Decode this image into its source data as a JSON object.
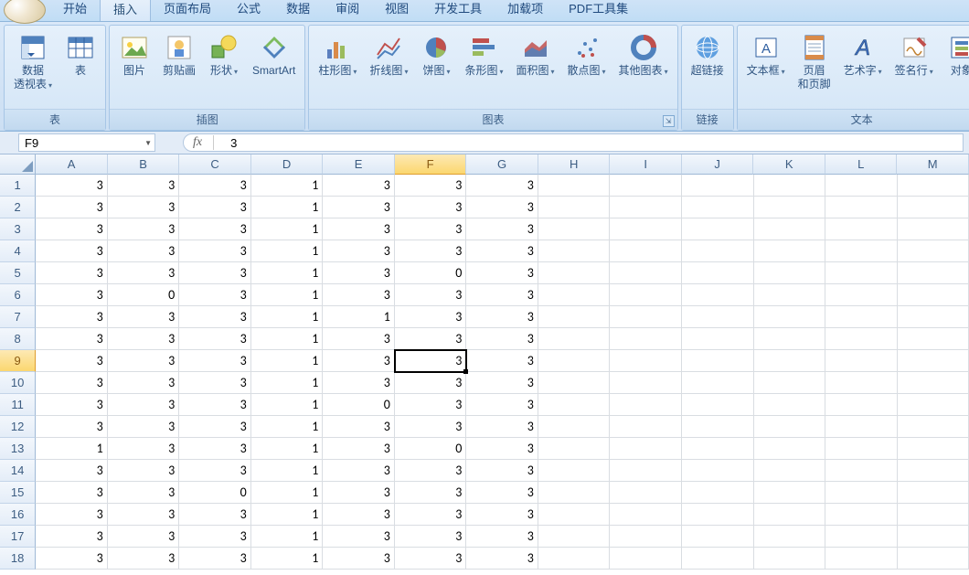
{
  "tabs": {
    "items": [
      "开始",
      "插入",
      "页面布局",
      "公式",
      "数据",
      "审阅",
      "视图",
      "开发工具",
      "加载项",
      "PDF工具集"
    ],
    "active_index": 1
  },
  "ribbon": {
    "groups": [
      {
        "label": "表",
        "items": [
          {
            "name": "pivot-table",
            "text": "数据\n透视表",
            "dd": true,
            "icon": "pivot"
          },
          {
            "name": "table",
            "text": "表",
            "icon": "table"
          }
        ]
      },
      {
        "label": "插图",
        "items": [
          {
            "name": "picture",
            "text": "图片",
            "icon": "picture"
          },
          {
            "name": "clipart",
            "text": "剪贴画",
            "icon": "clipart"
          },
          {
            "name": "shapes",
            "text": "形状",
            "dd": true,
            "icon": "shapes"
          },
          {
            "name": "smartart",
            "text": "SmartArt",
            "icon": "smartart"
          }
        ]
      },
      {
        "label": "图表",
        "launcher": true,
        "items": [
          {
            "name": "column-chart",
            "text": "柱形图",
            "dd": true,
            "icon": "column"
          },
          {
            "name": "line-chart",
            "text": "折线图",
            "dd": true,
            "icon": "line"
          },
          {
            "name": "pie-chart",
            "text": "饼图",
            "dd": true,
            "icon": "pie"
          },
          {
            "name": "bar-chart",
            "text": "条形图",
            "dd": true,
            "icon": "bar"
          },
          {
            "name": "area-chart",
            "text": "面积图",
            "dd": true,
            "icon": "area"
          },
          {
            "name": "scatter-chart",
            "text": "散点图",
            "dd": true,
            "icon": "scatter"
          },
          {
            "name": "other-chart",
            "text": "其他图表",
            "dd": true,
            "icon": "other"
          }
        ]
      },
      {
        "label": "链接",
        "items": [
          {
            "name": "hyperlink",
            "text": "超链接",
            "icon": "link"
          }
        ]
      },
      {
        "label": "文本",
        "items": [
          {
            "name": "textbox",
            "text": "文本框",
            "dd": true,
            "icon": "textbox"
          },
          {
            "name": "header-footer",
            "text": "页眉\n和页脚",
            "icon": "headerfooter"
          },
          {
            "name": "wordart",
            "text": "艺术字",
            "dd": true,
            "icon": "wordart"
          },
          {
            "name": "signature",
            "text": "签名行",
            "dd": true,
            "icon": "sig"
          },
          {
            "name": "object",
            "text": "对象",
            "icon": "object"
          }
        ]
      }
    ]
  },
  "formula_bar": {
    "namebox": "F9",
    "fx": "fx",
    "value": "3"
  },
  "grid": {
    "columns": [
      "A",
      "B",
      "C",
      "D",
      "E",
      "F",
      "G",
      "H",
      "I",
      "J",
      "K",
      "L",
      "M"
    ],
    "active": {
      "row": 9,
      "col": "F"
    },
    "rows": [
      [
        3,
        3,
        3,
        1,
        3,
        3,
        3
      ],
      [
        3,
        3,
        3,
        1,
        3,
        3,
        3
      ],
      [
        3,
        3,
        3,
        1,
        3,
        3,
        3
      ],
      [
        3,
        3,
        3,
        1,
        3,
        3,
        3
      ],
      [
        3,
        3,
        3,
        1,
        3,
        0,
        3
      ],
      [
        3,
        0,
        3,
        1,
        3,
        3,
        3
      ],
      [
        3,
        3,
        3,
        1,
        1,
        3,
        3
      ],
      [
        3,
        3,
        3,
        1,
        3,
        3,
        3
      ],
      [
        3,
        3,
        3,
        1,
        3,
        3,
        3
      ],
      [
        3,
        3,
        3,
        1,
        3,
        3,
        3
      ],
      [
        3,
        3,
        3,
        1,
        0,
        3,
        3
      ],
      [
        3,
        3,
        3,
        1,
        3,
        3,
        3
      ],
      [
        1,
        3,
        3,
        1,
        3,
        0,
        3
      ],
      [
        3,
        3,
        3,
        1,
        3,
        3,
        3
      ],
      [
        3,
        3,
        0,
        1,
        3,
        3,
        3
      ],
      [
        3,
        3,
        3,
        1,
        3,
        3,
        3
      ],
      [
        3,
        3,
        3,
        1,
        3,
        3,
        3
      ],
      [
        3,
        3,
        3,
        1,
        3,
        3,
        3
      ]
    ]
  }
}
